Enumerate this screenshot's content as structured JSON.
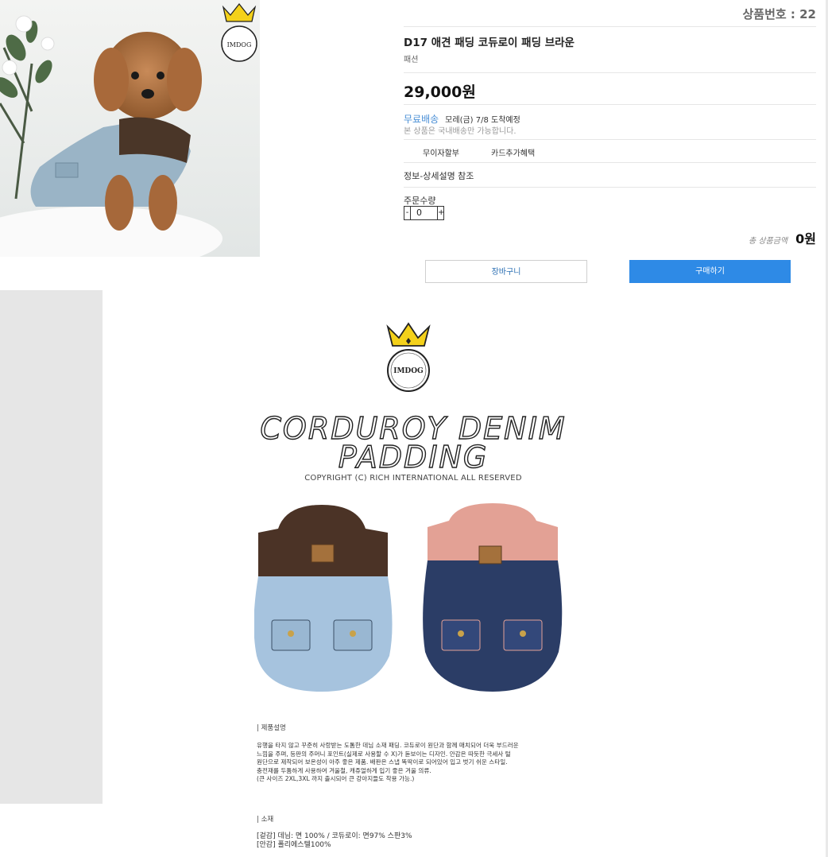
{
  "product": {
    "number_label": "상품번호 : 22",
    "title": "D17 애견 패딩 코듀로이 패딩 브라운",
    "category": "패션",
    "price": "29,000원",
    "shipping_free": "무료배송",
    "arrival": "모레(금) 7/8 도착예정",
    "shipping_note": "본 상품은 국내배송만 가능합니다.",
    "benefits": [
      "무이자할부",
      "카드추가혜택"
    ],
    "spec_info": "정보-상세설명 참조",
    "quantity_label": "주문수량",
    "quantity_minus": "-",
    "quantity_value": "0",
    "quantity_plus": "+",
    "total_label": "총 상품금액",
    "total_value": "0원",
    "cart_button": "장바구니",
    "buy_button": "구매하기"
  },
  "detail": {
    "logo_text": "IMDOG",
    "headline_line1": "CORDUROY DENIM",
    "headline_line2": "PADDING",
    "copyright": "COPYRIGHT (C) RICH INTERNATIONAL ALL RESERVED",
    "section_description_title": "| 제품설명",
    "description_lines": [
      "유행을 타지 않고 꾸준히 사랑받는 도톰한 데님 소재 패딩. 코듀로이 원단과 함께 매치되어 더욱 부드러운",
      "느낌을 주며, 등판의 주머니 포인트(실제로 사용할 수 X)가 돋보이는 디자인. 안감은 따듯한 극세사 털",
      "원단으로 제작되어 보온성이 아주 좋은 제품. 배판은 스냅 똑딱이로 되어있어 입고 벗기 쉬운 스타일.",
      "충전재를 두툼하게 사용하여 겨울철, 캐쥬얼하게 입기 좋은 겨울 의류.",
      "(큰 사이즈 2XL,3XL 까지 출시되어 큰 강아지들도 착용 가능.)"
    ],
    "section_material_title": "| 소재",
    "material_lines": [
      "[겉감] 데님: 면 100% / 코듀로이: 면97% 스판3%",
      "[안감] 폴리에스텔100%"
    ]
  },
  "colors": {
    "accent": "#2e8ae6",
    "link_blue": "#4a8fd6",
    "grey_block": "#e6e6e6"
  },
  "icons": [
    "crown-logo-icon"
  ]
}
